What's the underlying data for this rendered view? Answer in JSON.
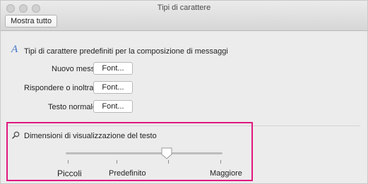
{
  "window": {
    "title": "Tipi di carattere"
  },
  "toolbar": {
    "show_all_label": "Mostra tutto"
  },
  "compose_section": {
    "icon": "font-style-icon",
    "icon_glyph": "A",
    "title": "Tipi di carattere predefiniti per la composizione di messaggi",
    "rows": [
      {
        "label": "Nuovo messaggio",
        "button": "Font..."
      },
      {
        "label": "Rispondere o inoltrare:",
        "button": "Font..."
      },
      {
        "label": "Testo normale:",
        "button": "Font..."
      }
    ]
  },
  "display_section": {
    "icon": "magnifier-icon",
    "title": "Dimensioni di visualizzazione del testo",
    "slider": {
      "labels": {
        "min": "Piccoli",
        "mid": "Predefinito",
        "max": "Maggiore"
      },
      "value_fraction": 0.65
    }
  },
  "colors": {
    "highlight": "#e0187f",
    "accent": "#3e73c9"
  }
}
